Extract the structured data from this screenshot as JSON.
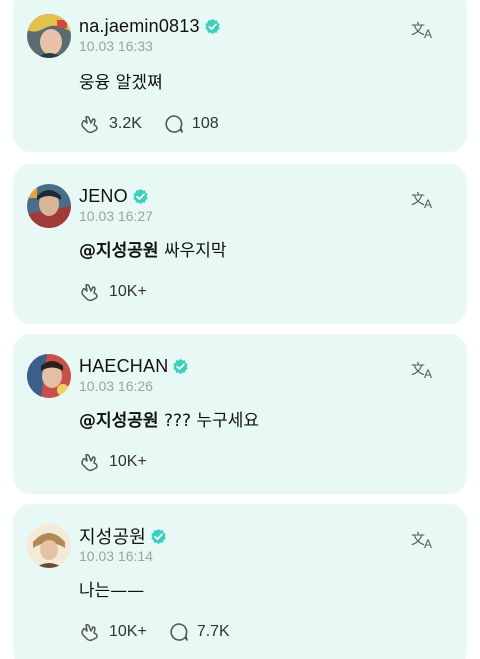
{
  "posts": [
    {
      "name": "na.jaemin0813",
      "time": "10.03 16:33",
      "mention": "",
      "text": "웅융 알겠쪄",
      "reaction_count": "3.2K",
      "comment_count": "108"
    },
    {
      "name": "JENO",
      "time": "10.03 16:27",
      "mention": "@지성공원",
      "text": " 싸우지막",
      "reaction_count": "10K+",
      "comment_count": ""
    },
    {
      "name": "HAECHAN",
      "time": "10.03 16:26",
      "mention": "@지성공원",
      "text": " ??? 누구세요",
      "reaction_count": "10K+",
      "comment_count": ""
    },
    {
      "name": "지성공원",
      "time": "10.03 16:14",
      "mention": "",
      "text": "나는——",
      "reaction_count": "10K+",
      "comment_count": "7.7K"
    }
  ],
  "icons": {
    "verified": "verified-badge-icon",
    "translate": "translate-icon",
    "reaction": "reaction-icon",
    "comment": "comment-icon"
  },
  "colors": {
    "card_background": "#e8f8f4",
    "verified": "#3ccfc0",
    "timestamp": "#9aa3a3"
  }
}
